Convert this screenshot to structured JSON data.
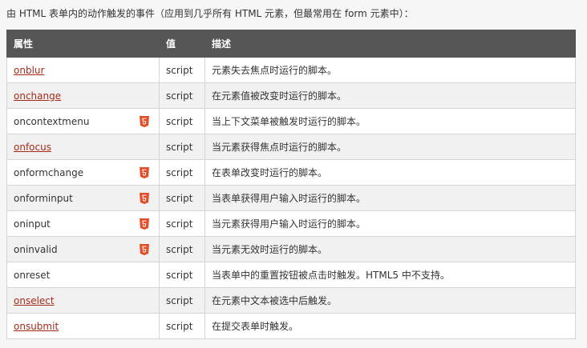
{
  "intro": "由 HTML 表单内的动作触发的事件（应用到几乎所有 HTML 元素，但最常用在 form 元素中）：",
  "table": {
    "headers": [
      "属性",
      "值",
      "描述"
    ],
    "rows": [
      {
        "attr": "onblur",
        "link": true,
        "html5": false,
        "value": "script",
        "desc": "元素失去焦点时运行的脚本。"
      },
      {
        "attr": "onchange",
        "link": true,
        "html5": false,
        "value": "script",
        "desc": "在元素值被改变时运行的脚本。"
      },
      {
        "attr": "oncontextmenu",
        "link": false,
        "html5": true,
        "value": "script",
        "desc": "当上下文菜单被触发时运行的脚本。"
      },
      {
        "attr": "onfocus",
        "link": true,
        "html5": false,
        "value": "script",
        "desc": "当元素获得焦点时运行的脚本。"
      },
      {
        "attr": "onformchange",
        "link": false,
        "html5": true,
        "value": "script",
        "desc": "在表单改变时运行的脚本。"
      },
      {
        "attr": "onforminput",
        "link": false,
        "html5": true,
        "value": "script",
        "desc": "当表单获得用户输入时运行的脚本。"
      },
      {
        "attr": "oninput",
        "link": false,
        "html5": true,
        "value": "script",
        "desc": "当元素获得用户输入时运行的脚本。"
      },
      {
        "attr": "oninvalid",
        "link": false,
        "html5": true,
        "value": "script",
        "desc": "当元素无效时运行的脚本。"
      },
      {
        "attr": "onreset",
        "link": false,
        "html5": false,
        "value": "script",
        "desc": "当表单中的重置按钮被点击时触发。HTML5 中不支持。"
      },
      {
        "attr": "onselect",
        "link": true,
        "html5": false,
        "value": "script",
        "desc": "在元素中文本被选中后触发。"
      },
      {
        "attr": "onsubmit",
        "link": true,
        "html5": false,
        "value": "script",
        "desc": "在提交表单时触发。"
      }
    ]
  },
  "html5_badge": {
    "icon": "html5-shield-icon",
    "color": "#e44d26"
  },
  "colors": {
    "header_bg": "#555555",
    "link": "#a52a1a",
    "row_alt": "#f1f1f1"
  }
}
